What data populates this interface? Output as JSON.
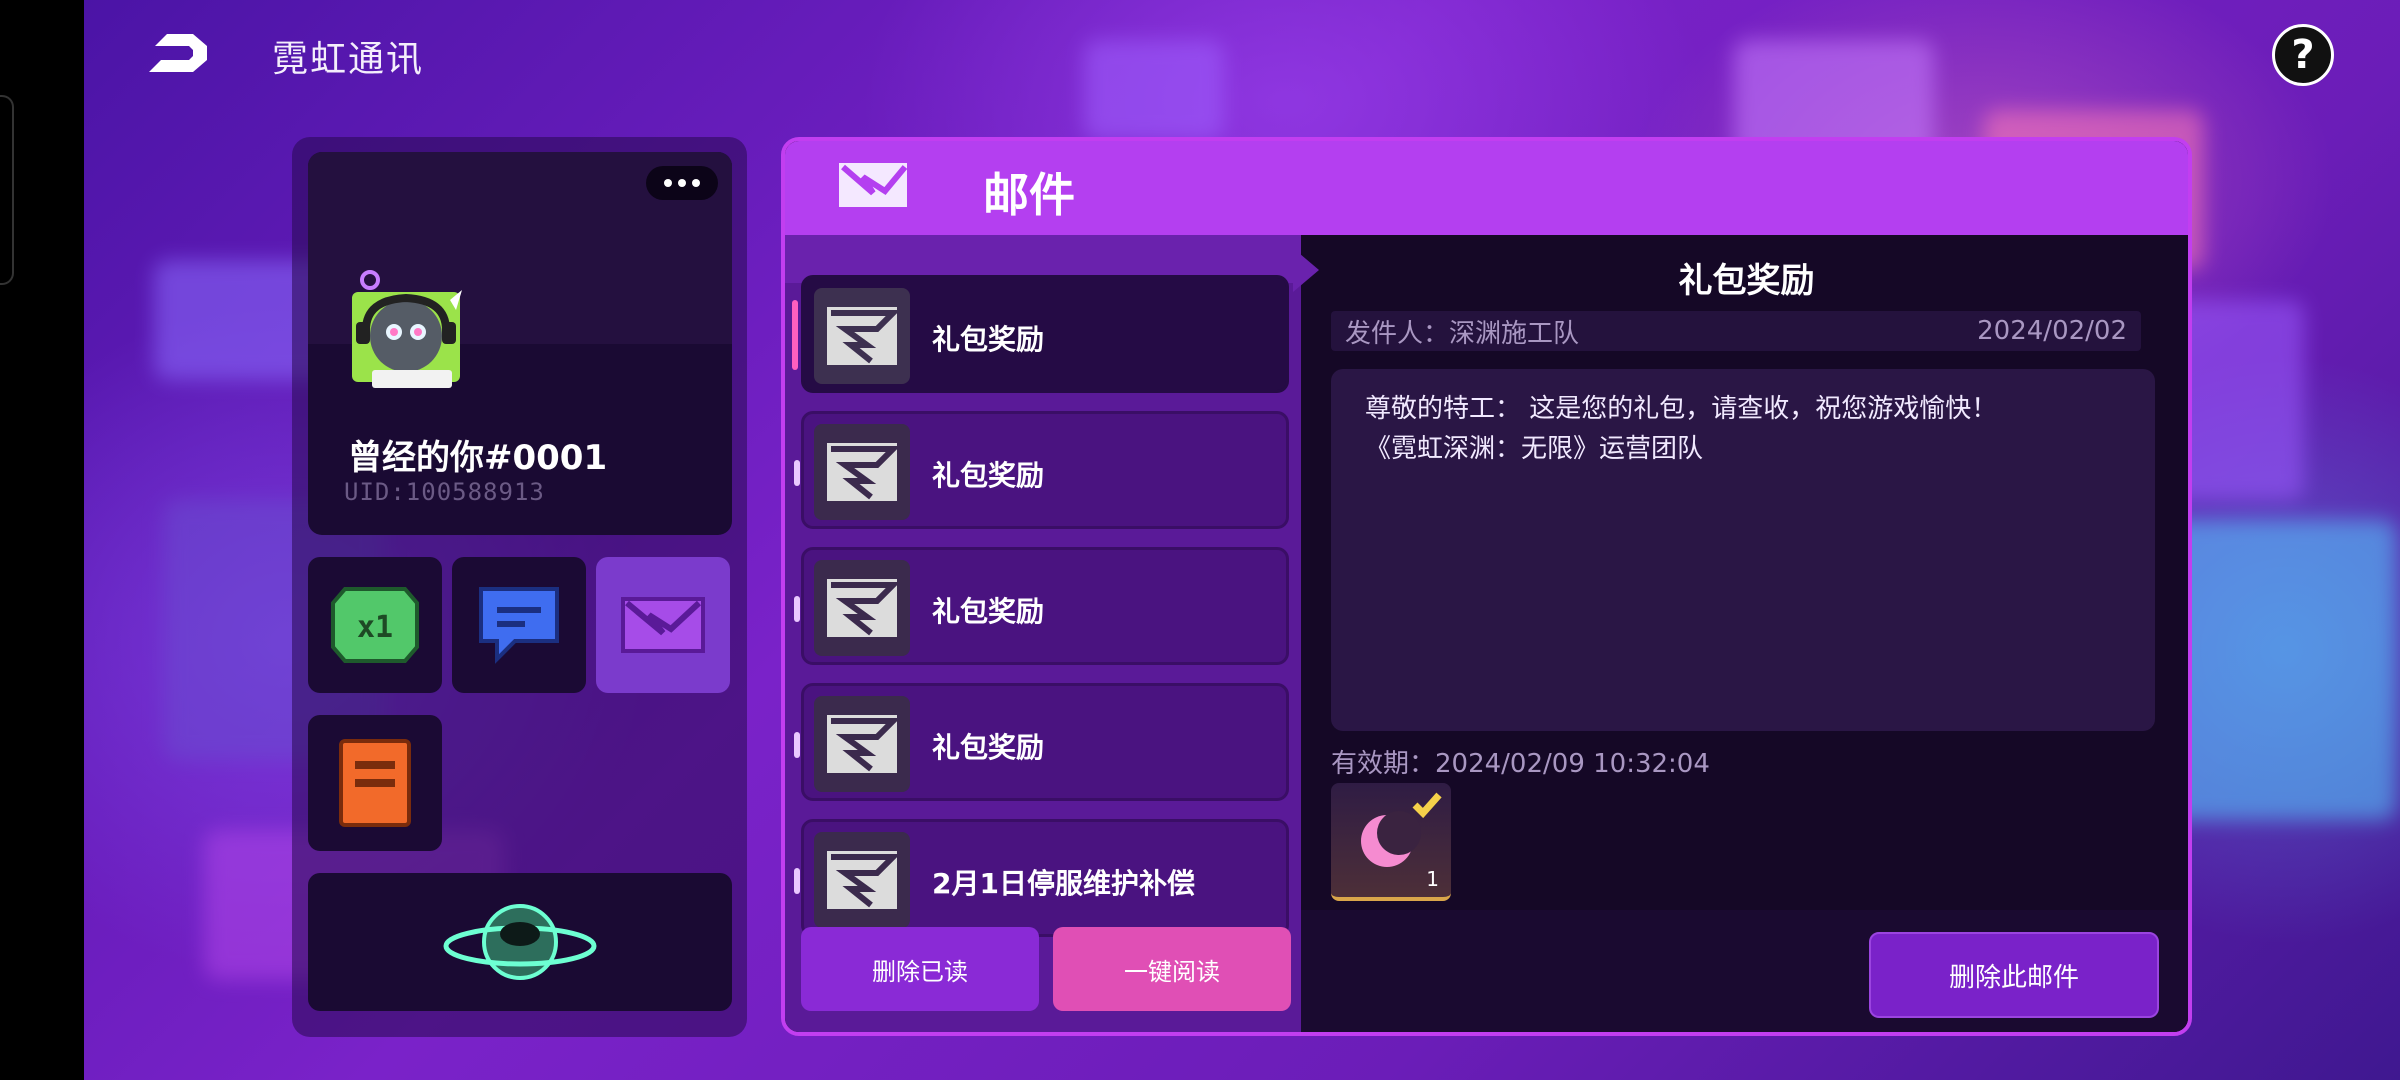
{
  "app": {
    "title": "霓虹通讯"
  },
  "profile": {
    "nickname": "曾经的你#0001",
    "uid": "UID:100588913"
  },
  "mail": {
    "header_title": "邮件",
    "items": [
      {
        "label": "礼包奖励",
        "selected": true
      },
      {
        "label": "礼包奖励",
        "selected": false
      },
      {
        "label": "礼包奖励",
        "selected": false
      },
      {
        "label": "礼包奖励",
        "selected": false
      },
      {
        "label": "2月1日停服维护补偿",
        "selected": false
      }
    ],
    "buttons": {
      "delete_read": "删除已读",
      "read_all": "一键阅读",
      "delete_this": "删除此邮件"
    },
    "detail": {
      "title": "礼包奖励",
      "sender": "发件人：深渊施工队",
      "date": "2024/02/02",
      "body_line1": "尊敬的特工： 这是您的礼包，请查收，祝您游戏愉快！",
      "body_line2": "《霓虹深渊：无限》运营团队",
      "expiry": "有效期：2024/02/09 10:32:04",
      "reward_count": "1",
      "reward_icon": "crescent-moon-item-icon"
    }
  },
  "colors": {
    "accent": "#b43ff0",
    "pink_button": "#e04fb5",
    "purple_button": "#8a2ad6",
    "panel_dark": "#150826"
  }
}
